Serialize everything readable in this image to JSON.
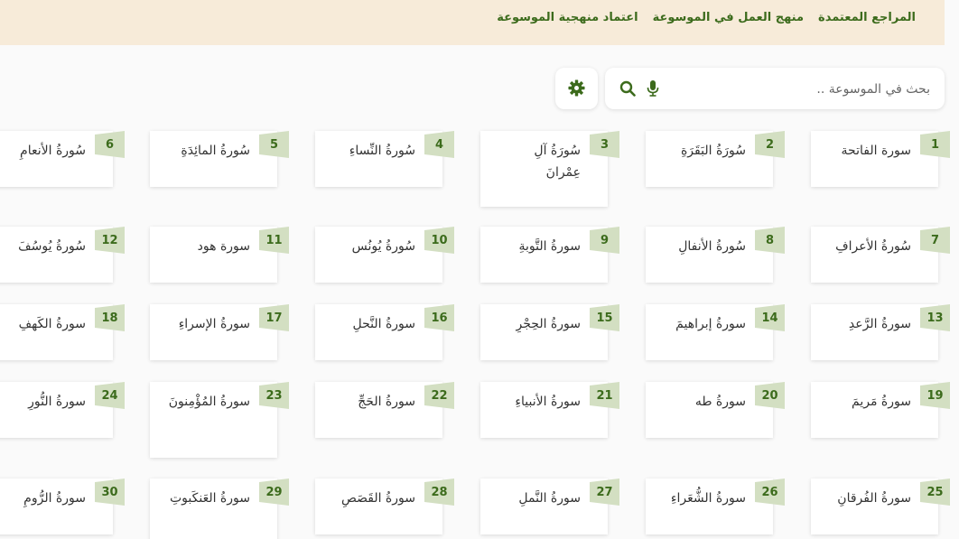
{
  "nav": {
    "links": [
      "المراجع المعتمدة",
      "منهج العمل في الموسوعة",
      "اعتماد منهجية الموسوعة"
    ]
  },
  "search": {
    "placeholder": "بحث في الموسوعة .."
  },
  "colors": {
    "accent": "#3c6b1c",
    "badge_bg": "#d3dfc2",
    "topbar_bg": "#f7ebd9"
  },
  "surahs": [
    {
      "number": "1",
      "name": "سورة الفاتحة"
    },
    {
      "number": "2",
      "name": "سُورَةُ البَقَرَةِ"
    },
    {
      "number": "3",
      "name": "سُورَةُ آلِ عِمْرانَ"
    },
    {
      "number": "4",
      "name": "سُورةُ النِّساءِ"
    },
    {
      "number": "5",
      "name": "سُورةُ المائِدَةِ"
    },
    {
      "number": "6",
      "name": "سُورةُ الأنعامِ"
    },
    {
      "number": "7",
      "name": "سُورةُ الأعرافِ"
    },
    {
      "number": "8",
      "name": "سُورةُ الأنفالِ"
    },
    {
      "number": "9",
      "name": "سورةُ التَّوبةِ"
    },
    {
      "number": "10",
      "name": "سُورةُ يُونُس"
    },
    {
      "number": "11",
      "name": "سورة هود"
    },
    {
      "number": "12",
      "name": "سُورةُ يُوسُفَ"
    },
    {
      "number": "13",
      "name": "سورةُ الرَّعدِ"
    },
    {
      "number": "14",
      "name": "سورةُ إبراهيمَ"
    },
    {
      "number": "15",
      "name": "سورةُ الحِجْرِ"
    },
    {
      "number": "16",
      "name": "سورةُ النَّحلِ"
    },
    {
      "number": "17",
      "name": "سورةُ الإسراءِ"
    },
    {
      "number": "18",
      "name": "سورةُ الكَهفِ"
    },
    {
      "number": "19",
      "name": "سورةُ مَريمَ"
    },
    {
      "number": "20",
      "name": "سورةُ طه"
    },
    {
      "number": "21",
      "name": "سورةُ الأنبياءِ"
    },
    {
      "number": "22",
      "name": "سورةُ الحَجِّ"
    },
    {
      "number": "23",
      "name": "سورةُ المُؤْمِنونَ"
    },
    {
      "number": "24",
      "name": "سورةُ النُّورِ"
    },
    {
      "number": "25",
      "name": "سورةُ الفُرقانِ"
    },
    {
      "number": "26",
      "name": "سورةُ الشُّعَراءِ"
    },
    {
      "number": "27",
      "name": "سورةُ النَّملِ"
    },
    {
      "number": "28",
      "name": "سورةُ القَصَصِ"
    },
    {
      "number": "29",
      "name": "سورةُ العَنكَبوتِ"
    },
    {
      "number": "30",
      "name": "سورةُ الرُّومِ"
    }
  ]
}
